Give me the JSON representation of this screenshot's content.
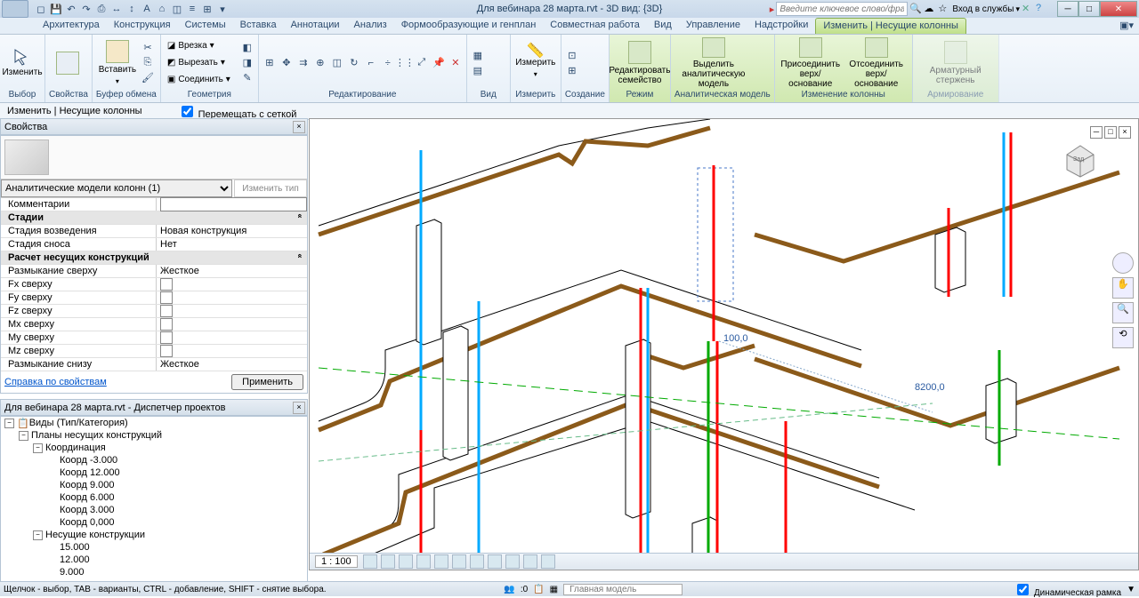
{
  "title": "Для вебинара 28 марта.rvt - 3D вид: {3D}",
  "search_placeholder": "Введите ключевое слово/фразу",
  "signin": "Вход в службы",
  "tabs": [
    "Архитектура",
    "Конструкция",
    "Системы",
    "Вставка",
    "Аннотации",
    "Анализ",
    "Формообразующие и генплан",
    "Совместная работа",
    "Вид",
    "Управление",
    "Надстройки",
    "Изменить | Несущие колонны"
  ],
  "active_tab": "Изменить | Несущие колонны",
  "ribbon": {
    "select": {
      "btn": "Изменить",
      "label": "Выбор"
    },
    "props": {
      "label": "Свойства"
    },
    "clipboard": {
      "paste": "Вставить",
      "label": "Буфер обмена"
    },
    "geometry": {
      "label": "Геометрия",
      "cut": "Врезка",
      "cut2": "Вырезать",
      "join": "Соединить"
    },
    "edit": {
      "label": "Редактирование"
    },
    "view": {
      "label": "Вид"
    },
    "measure": {
      "btn": "Измерить",
      "label": "Измерить"
    },
    "create": {
      "label": "Создание"
    },
    "mode": {
      "btn": "Редактировать семейство",
      "label": "Режим"
    },
    "analytical": {
      "btn": "Выделить аналитическую модель",
      "label": "Аналитическая модель"
    },
    "modcol": {
      "b1": "Присоединить верх/основание",
      "b2": "Отсоединить верх/основание",
      "label": "Изменение колонны"
    },
    "rebar": {
      "btn": "Арматурный стержень",
      "label": "Армирование"
    }
  },
  "options": {
    "ctx": "Изменить | Несущие колонны",
    "move": "Перемещать с сеткой"
  },
  "props": {
    "title": "Свойства",
    "type_select": "Аналитические модели колонн (1)",
    "edit_type": "Изменить тип",
    "rows": {
      "comments_l": "Комментарии",
      "comments_v": "",
      "phases": "Стадии",
      "phase_created_l": "Стадия возведения",
      "phase_created_v": "Новая конструкция",
      "phase_demo_l": "Стадия сноса",
      "phase_demo_v": "Нет",
      "struct": "Расчет несущих конструкций",
      "top_release_l": "Размыкание сверху",
      "top_release_v": "Жесткое",
      "fx_l": "Fx сверху",
      "fy_l": "Fy сверху",
      "fz_l": "Fz сверху",
      "mx_l": "Mx сверху",
      "my_l": "My сверху",
      "mz_l": "Mz сверху",
      "bot_release_l": "Размыкание снизу",
      "bot_release_v": "Жесткое"
    },
    "help": "Справка по свойствам",
    "apply": "Применить"
  },
  "browser": {
    "title": "Для вебинара 28 марта.rvt - Диспетчер проектов",
    "root": "Виды (Тип/Категория)",
    "plans": "Планы несущих конструкций",
    "coord": "Координация",
    "items": [
      "Коорд -3.000",
      "Коорд 12.000",
      "Коорд 9.000",
      "Коорд 6.000",
      "Коорд 3.000",
      "Коорд 0,000"
    ],
    "struct": "Несущие конструкции",
    "struct_items": [
      "15.000",
      "12.000",
      "9.000"
    ]
  },
  "canvas": {
    "dim1": "100,0",
    "dim2": "8200,0"
  },
  "viewbar": {
    "scale": "1 : 100"
  },
  "status": {
    "hint": "Щелчок - выбор, TAB - варианты, CTRL - добавление, SHIFT - снятие выбора.",
    "zero": ":0",
    "model": "Главная модель",
    "dynframe": "Динамическая рамка"
  }
}
